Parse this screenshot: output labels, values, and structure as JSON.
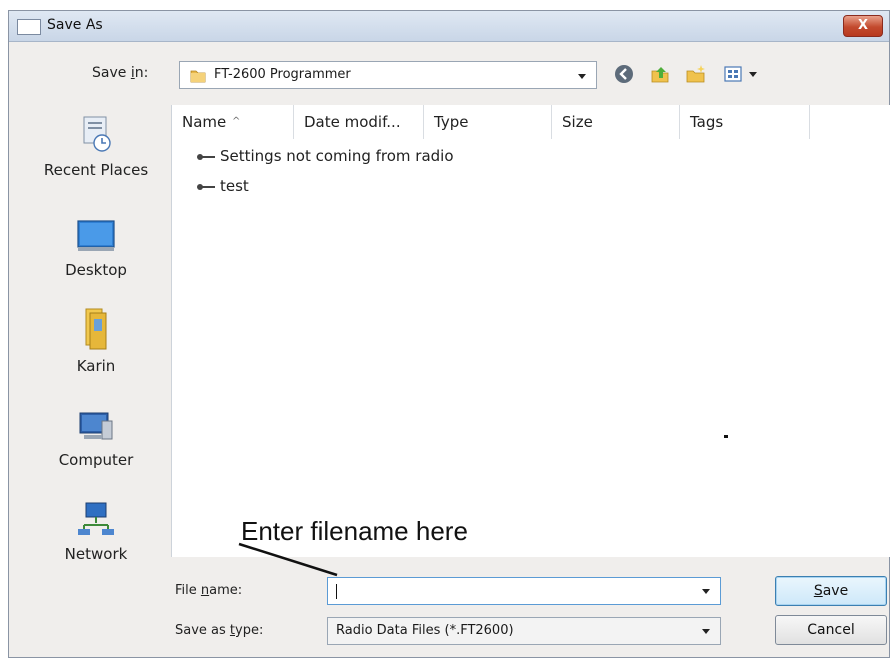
{
  "window": {
    "title": "Save As",
    "close_label": "X"
  },
  "toolbar": {
    "save_in_label_pre": "Save ",
    "save_in_label_ul": "i",
    "save_in_label_post": "n:",
    "current_folder": "FT-2600 Programmer",
    "icons": [
      "back-icon",
      "up-folder-icon",
      "new-folder-icon",
      "views-icon"
    ]
  },
  "places": [
    {
      "label": "Recent Places",
      "icon": "recent-places-icon"
    },
    {
      "label": "Desktop",
      "icon": "desktop-icon"
    },
    {
      "label": "Karin",
      "icon": "user-folder-icon"
    },
    {
      "label": "Computer",
      "icon": "computer-icon"
    },
    {
      "label": "Network",
      "icon": "network-icon"
    }
  ],
  "columns": [
    "Name",
    "Date modif...",
    "Type",
    "Size",
    "Tags"
  ],
  "files": [
    {
      "name": "Settings not coming from radio"
    },
    {
      "name": "test"
    }
  ],
  "annotation": {
    "hint": "Enter filename here"
  },
  "form": {
    "filename_label_pre": "File ",
    "filename_label_ul": "n",
    "filename_label_post": "ame:",
    "filename_value": "",
    "savetype_label_pre": "Save as ",
    "savetype_label_ul": "t",
    "savetype_label_post": "ype:",
    "savetype_value": "Radio Data Files (*.FT2600)"
  },
  "buttons": {
    "save_ul": "S",
    "save_rest": "ave",
    "cancel": "Cancel"
  },
  "colors": {
    "dialog_bg": "#f0eeec",
    "title_gradient": "#c9d6e7",
    "close_red": "#c34a2e"
  }
}
